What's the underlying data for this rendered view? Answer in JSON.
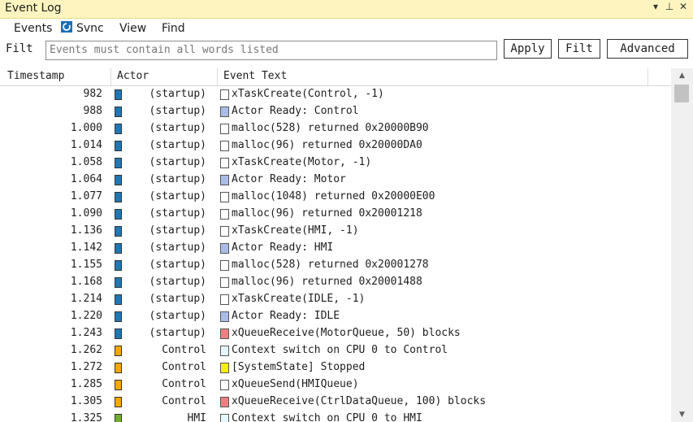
{
  "window": {
    "title": "Event Log"
  },
  "menu": {
    "events": "Events",
    "sync": "Svnc",
    "view": "View",
    "find": "Find"
  },
  "filter": {
    "label": "Filt",
    "placeholder": "Events must contain all words listed",
    "apply": "Apply",
    "filt": "Filt",
    "advanced": "Advanced"
  },
  "columns": {
    "timestamp": "Timestamp",
    "actor": "Actor",
    "event": "Event Text"
  },
  "colors": {
    "startup": "#1f77b4",
    "control": "#f5a800",
    "hmi": "#6fae2f",
    "ev_white": "#ffffff",
    "ev_blue": "#a9bde8",
    "ev_red": "#ee7f7f",
    "ev_yellow": "#f5f000",
    "ev_cyan": "#e6f8ff"
  },
  "rows": [
    {
      "ts": "982",
      "actor": "(startup)",
      "actor_color": "#1f77b4",
      "ev_color": "#ffffff",
      "text": "xTaskCreate(Control, -1)"
    },
    {
      "ts": "988",
      "actor": "(startup)",
      "actor_color": "#1f77b4",
      "ev_color": "#a9bde8",
      "text": "Actor Ready: Control"
    },
    {
      "ts": "1.000",
      "actor": "(startup)",
      "actor_color": "#1f77b4",
      "ev_color": "#ffffff",
      "text": "malloc(528) returned 0x20000B90"
    },
    {
      "ts": "1.014",
      "actor": "(startup)",
      "actor_color": "#1f77b4",
      "ev_color": "#ffffff",
      "text": "malloc(96) returned 0x20000DA0"
    },
    {
      "ts": "1.058",
      "actor": "(startup)",
      "actor_color": "#1f77b4",
      "ev_color": "#ffffff",
      "text": "xTaskCreate(Motor, -1)"
    },
    {
      "ts": "1.064",
      "actor": "(startup)",
      "actor_color": "#1f77b4",
      "ev_color": "#a9bde8",
      "text": "Actor Ready: Motor"
    },
    {
      "ts": "1.077",
      "actor": "(startup)",
      "actor_color": "#1f77b4",
      "ev_color": "#ffffff",
      "text": "malloc(1048) returned 0x20000E00"
    },
    {
      "ts": "1.090",
      "actor": "(startup)",
      "actor_color": "#1f77b4",
      "ev_color": "#ffffff",
      "text": "malloc(96) returned 0x20001218"
    },
    {
      "ts": "1.136",
      "actor": "(startup)",
      "actor_color": "#1f77b4",
      "ev_color": "#ffffff",
      "text": "xTaskCreate(HMI, -1)"
    },
    {
      "ts": "1.142",
      "actor": "(startup)",
      "actor_color": "#1f77b4",
      "ev_color": "#a9bde8",
      "text": "Actor Ready: HMI"
    },
    {
      "ts": "1.155",
      "actor": "(startup)",
      "actor_color": "#1f77b4",
      "ev_color": "#ffffff",
      "text": "malloc(528) returned 0x20001278"
    },
    {
      "ts": "1.168",
      "actor": "(startup)",
      "actor_color": "#1f77b4",
      "ev_color": "#ffffff",
      "text": "malloc(96) returned 0x20001488"
    },
    {
      "ts": "1.214",
      "actor": "(startup)",
      "actor_color": "#1f77b4",
      "ev_color": "#ffffff",
      "text": "xTaskCreate(IDLE, -1)"
    },
    {
      "ts": "1.220",
      "actor": "(startup)",
      "actor_color": "#1f77b4",
      "ev_color": "#a9bde8",
      "text": "Actor Ready: IDLE"
    },
    {
      "ts": "1.243",
      "actor": "(startup)",
      "actor_color": "#1f77b4",
      "ev_color": "#ee7f7f",
      "text": "xQueueReceive(MotorQueue, 50) blocks"
    },
    {
      "ts": "1.262",
      "actor": "Control",
      "actor_color": "#f5a800",
      "ev_color": "#e6f8ff",
      "text": "Context switch on CPU 0 to Control"
    },
    {
      "ts": "1.272",
      "actor": "Control",
      "actor_color": "#f5a800",
      "ev_color": "#f5f000",
      "text": "[SystemState] Stopped"
    },
    {
      "ts": "1.285",
      "actor": "Control",
      "actor_color": "#f5a800",
      "ev_color": "#ffffff",
      "text": "xQueueSend(HMIQueue)"
    },
    {
      "ts": "1.305",
      "actor": "Control",
      "actor_color": "#f5a800",
      "ev_color": "#ee7f7f",
      "text": "xQueueReceive(CtrlDataQueue, 100) blocks"
    },
    {
      "ts": "1.325",
      "actor": "HMI",
      "actor_color": "#6fae2f",
      "ev_color": "#e6f8ff",
      "text": "Context switch on CPU 0 to HMI"
    }
  ]
}
